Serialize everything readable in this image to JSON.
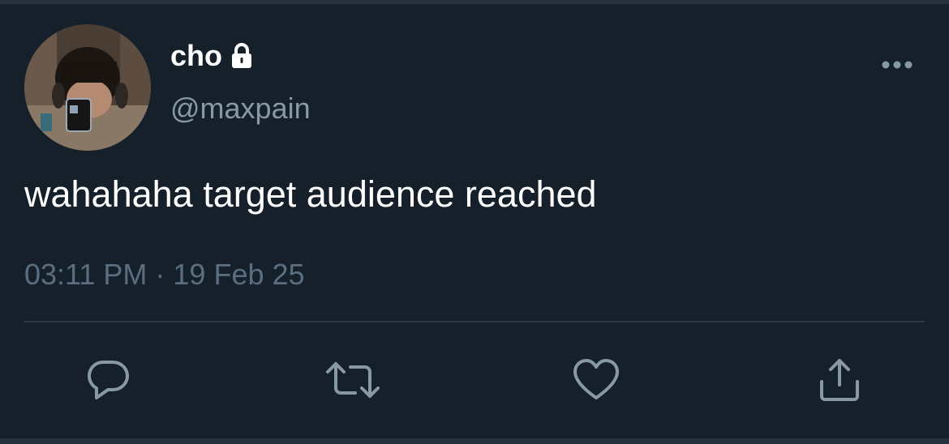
{
  "tweet": {
    "display_name": "cho",
    "handle": "@maxpain",
    "text": "wahahaha target audience reached",
    "meta": "03:11 PM · 19 Feb 25"
  },
  "icons": {
    "protected": "lock-icon",
    "more": "more-icon",
    "reply": "reply-icon",
    "retweet": "retweet-icon",
    "like": "heart-icon",
    "share": "share-icon"
  },
  "colors": {
    "background": "#15202b",
    "primary_text": "#ffffff",
    "secondary_text": "#8899a6",
    "icon": "#8899a6",
    "divider": "#2c3845"
  }
}
